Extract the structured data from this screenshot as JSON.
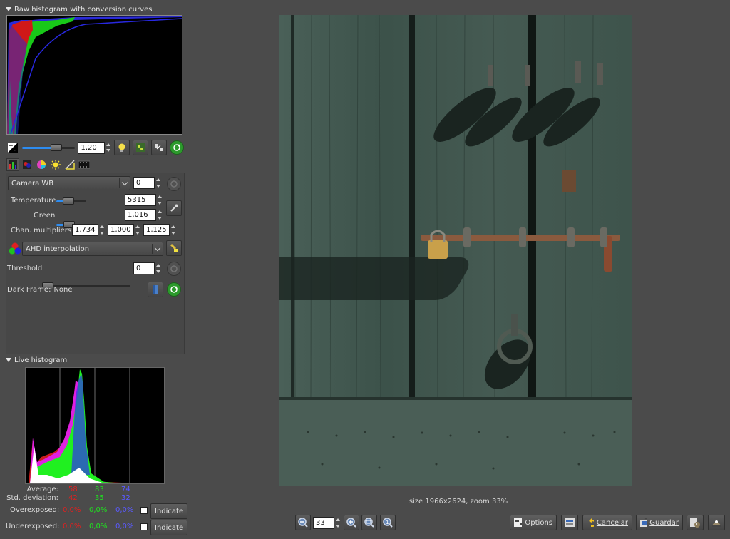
{
  "raw_histogram": {
    "title": "Raw histogram with conversion curves"
  },
  "exposure": {
    "value": "1,20"
  },
  "wb": {
    "preset": "Camera WB",
    "preset_spin": "0",
    "temperature_label": "Temperature",
    "temperature_value": "5315",
    "temperature_level": 0.35,
    "green_label": "Green",
    "green_value": "1,016",
    "green_level": 0.4,
    "chan_label": "Chan. multipliers:",
    "chan_values": [
      "1,734",
      "1,000",
      "1,125"
    ]
  },
  "interpolation": {
    "value": "AHD interpolation"
  },
  "threshold": {
    "label": "Threshold",
    "value": "0"
  },
  "dark_frame": {
    "label": "Dark Frame:",
    "value": "None"
  },
  "live_histogram": {
    "title": "Live histogram",
    "average_label": "Average:",
    "average": [
      "58",
      "83",
      "74"
    ],
    "std_label": "Std. deviation:",
    "std": [
      "42",
      "35",
      "32"
    ],
    "over_label": "Overexposed:",
    "over": [
      "0,0%",
      "0,0%",
      "0,0%"
    ],
    "under_label": "Underexposed:",
    "under": [
      "0,0%",
      "0,0%",
      "0,0%"
    ],
    "indicate_label": "Indicate",
    "colors": {
      "red": "#e02020",
      "green": "#20e020",
      "blue": "#3a3af0"
    }
  },
  "status": {
    "text": "size 1966x2624, zoom 33%"
  },
  "toolbar": {
    "zoom_value": "33",
    "options_label": "Options",
    "cancel_label": "Cancelar",
    "save_label": "Guardar"
  },
  "icons": {
    "zoom_out": "zoom-out-icon",
    "zoom_in": "zoom-in-icon",
    "zoom_fit": "zoom-fit-icon",
    "zoom_100": "zoom-100-icon"
  }
}
